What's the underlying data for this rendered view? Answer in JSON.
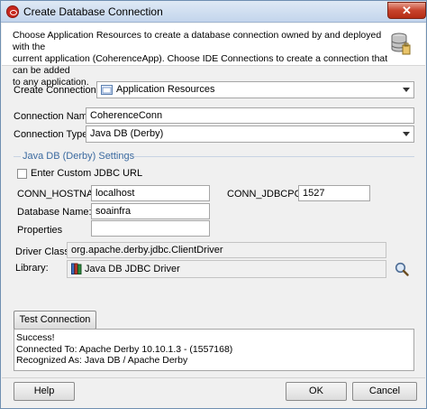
{
  "window": {
    "title": "Create Database Connection",
    "close_glyph": "✕"
  },
  "header": {
    "line1": "Choose Application Resources to create a database connection owned by and deployed with the",
    "line2": "current application (CoherenceApp). Choose IDE Connections to create a connection that can be added",
    "line3": "to any application."
  },
  "form": {
    "create_in_label": "Create Connection In:",
    "create_in_value": "Application Resources",
    "connection_name_label": "Connection Name:",
    "connection_name_value": "CoherenceConn",
    "connection_type_label": "Connection Type:",
    "connection_type_value": "Java DB (Derby)"
  },
  "settings": {
    "title": "Java DB (Derby) Settings",
    "custom_jdbc_label": "Enter Custom JDBC URL",
    "custom_jdbc_checked": false,
    "hostname_label": "CONN_HOSTNAME",
    "hostname_value": "localhost",
    "port_label": "CONN_JDBCPORT",
    "port_value": "1527",
    "database_name_label": "Database Name:",
    "database_name_value": "soainfra",
    "properties_label": "Properties",
    "properties_value": "",
    "driver_class_label": "Driver Class:",
    "driver_class_value": "org.apache.derby.jdbc.ClientDriver",
    "library_label": "Library:",
    "library_value": "Java DB JDBC Driver"
  },
  "test": {
    "button_label": "Test Connection",
    "result_line1": "Success!",
    "result_line2": "Connected To: Apache Derby 10.10.1.3 - (1557168)",
    "result_line3": "Recognized As: Java DB / Apache Derby"
  },
  "footer": {
    "help_label": "Help",
    "ok_label": "OK",
    "cancel_label": "Cancel"
  },
  "colors": {
    "accent": "#3b6aa0",
    "close": "#c7432c"
  },
  "icons": [
    "oracle-app-icon",
    "database-icon",
    "combo-arrow-icon",
    "library-icon",
    "search-icon"
  ]
}
